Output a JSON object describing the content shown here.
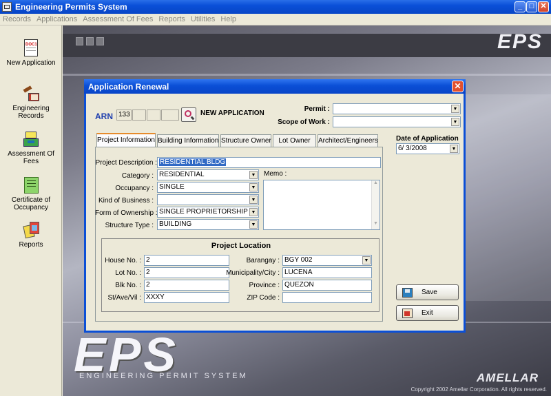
{
  "window": {
    "title": "Engineering Permits System"
  },
  "menu": [
    "Records",
    "Applications",
    "Assessment Of Fees",
    "Reports",
    "Utilities",
    "Help"
  ],
  "sidebar": {
    "items": [
      {
        "label": "New Application",
        "icon": "document-icon",
        "icon_text": "DOC1"
      },
      {
        "label": "Engineering Records",
        "icon": "hammer-books-icon"
      },
      {
        "label": "Assessment Of Fees",
        "icon": "cash-register-icon"
      },
      {
        "label": "Certificate of Occupancy",
        "icon": "certificate-icon"
      },
      {
        "label": "Reports",
        "icon": "reports-icon"
      }
    ]
  },
  "background": {
    "logo_top": "EPS",
    "logo_big": "EPS",
    "subtitle": "ENGINEERING PERMIT SYSTEM",
    "brand": "AMELLAR",
    "copyright": "Copyright 2002 Amellar Corporation. All rights reserved."
  },
  "dialog": {
    "title": "Application Renewal",
    "arn_label": "ARN",
    "arn_values": [
      "133",
      "",
      "",
      ""
    ],
    "status": "NEW APPLICATION",
    "permit_label": "Permit :",
    "permit_value": "",
    "scope_label": "Scope of Work :",
    "scope_value": "",
    "date_label": "Date of Application",
    "date_value": "6/ 3/2008",
    "tabs": [
      "Project Information",
      "Building Information",
      "Structure Owner",
      "Lot Owner",
      "Architect/Engineers"
    ],
    "active_tab": 0,
    "project": {
      "desc_label": "Project Description :",
      "desc_value": "RESIDENTIAL BLDG",
      "category_label": "Category :",
      "category_value": "RESIDENTIAL",
      "occupancy_label": "Occupancy :",
      "occupancy_value": "SINGLE",
      "business_label": "Kind of Business :",
      "business_value": "",
      "ownership_label": "Form of Ownership :",
      "ownership_value": "SINGLE PROPRIETORSHIP",
      "structure_label": "Structure Type :",
      "structure_value": "BUILDING",
      "memo_label": "Memo :",
      "memo_value": ""
    },
    "location": {
      "title": "Project Location",
      "house_label": "House No. :",
      "house_value": "2",
      "lot_label": "Lot No. :",
      "lot_value": "2",
      "blk_label": "Blk No. :",
      "blk_value": "2",
      "street_label": "St/Ave/Vil :",
      "street_value": "XXXY",
      "barangay_label": "Barangay :",
      "barangay_value": "BGY 002",
      "municipality_label": "Municipality/City :",
      "municipality_value": "LUCENA",
      "province_label": "Province :",
      "province_value": "QUEZON",
      "zip_label": "ZIP Code :",
      "zip_value": ""
    },
    "buttons": {
      "save": "Save",
      "exit": "Exit"
    }
  },
  "colors": {
    "titlebar": "#0a4fd8",
    "dialog_border": "#0b4fd6",
    "arn_label": "#1f3fae",
    "tab_highlight": "#e68b2c"
  }
}
